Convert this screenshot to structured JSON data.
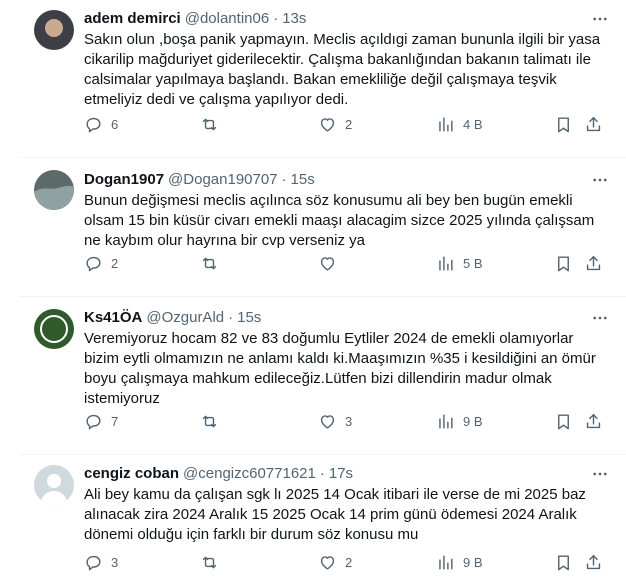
{
  "tweets": [
    {
      "name": "adem demirci",
      "handle": "@dolantin06",
      "time": "13s",
      "text": "Sakın olun ,boşa panik yapmayın. Meclis açıldıgi zaman bununla ilgili bir yasa cikarilip mağduriyet giderilecektir. Çalışma bakanlığından bakanın talimatı ile calsimalar yapılmaya başlandı. Bakan emekliliğe değil çalışmaya teşvik etmeliyiz dedi ve çalışma yapılıyor dedi.",
      "replies": "6",
      "retweets": "",
      "likes": "2",
      "views": "4 B",
      "avatar_color": "#3c3f45"
    },
    {
      "name": "Dogan1907",
      "handle": "@Dogan190707",
      "time": "15s",
      "text": "Bunun değişmesi meclis açılınca söz konusumu  ali bey ben bugün emekli olsam 15 bin küsür civarı emekli maaşı alacagim sizce 2025 yılında çalışsam ne kaybım olur hayrına bir cvp verseniz ya",
      "replies": "2",
      "retweets": "",
      "likes": "",
      "views": "5 B",
      "avatar_color": "#5c6a6a"
    },
    {
      "name": "Ks41ÖA",
      "handle": "@OzgurAld",
      "time": "15s",
      "text": "Veremiyoruz hocam 82 ve 83 doğumlu Eytliler 2024 de emekli olamıyorlar bizim eytli olmamızın ne anlamı kaldı ki.Maaşımızın %35 i kesildiğini an ömür boyu çalışmaya mahkum edileceğiz.Lütfen bizi dillendirin madur olmak istemiyoruz",
      "replies": "7",
      "retweets": "",
      "likes": "3",
      "views": "9 B",
      "avatar_color": "#2f5a2c"
    },
    {
      "name": "cengiz coban",
      "handle": "@cengizc60771621",
      "time": "17s",
      "text": "Ali bey kamu  da çalışan sgk lı 2025 14 Ocak itibari ile verse de mi 2025 baz alınacak zira 2024 Aralık 15 2025 Ocak 14 prim günü ödemesi 2024 Aralık dönemi olduğu için farklı bir durum söz konusu mu",
      "replies": "3",
      "retweets": "",
      "likes": "2",
      "views": "9 B",
      "avatar_color": "#cfd9de"
    }
  ],
  "icons": {
    "more": "more-icon",
    "reply": "reply-icon",
    "retweet": "retweet-icon",
    "like": "like-icon",
    "views": "views-icon",
    "bookmark": "bookmark-icon",
    "share": "share-icon"
  },
  "separator": "·",
  "more_glyph": "···"
}
